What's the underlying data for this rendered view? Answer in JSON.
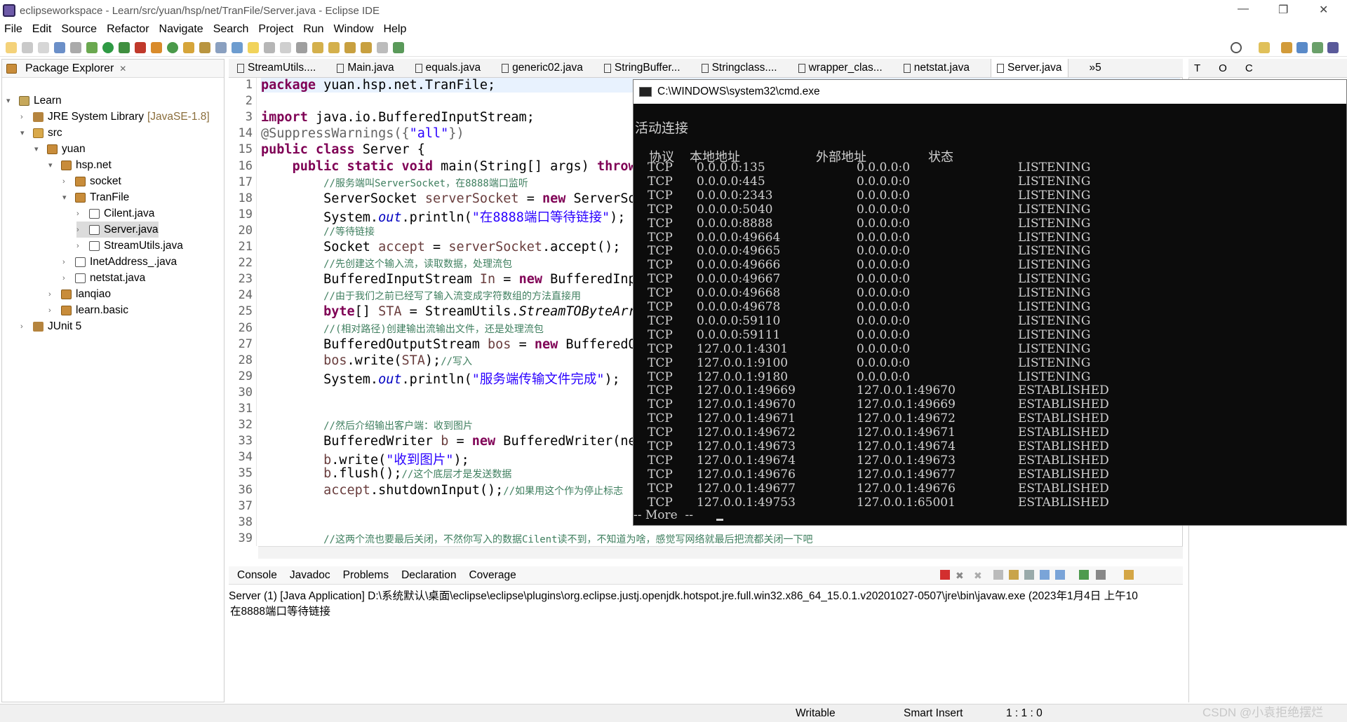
{
  "window": {
    "title": "eclipseworkspace - Learn/src/yuan/hsp/net/TranFile/Server.java - Eclipse IDE"
  },
  "menu": [
    "File",
    "Edit",
    "Source",
    "Refactor",
    "Navigate",
    "Search",
    "Project",
    "Run",
    "Window",
    "Help"
  ],
  "package_explorer": {
    "title": "Package Explorer",
    "tree": [
      {
        "label": "Learn",
        "icon": "project-icon",
        "twisty": "▾"
      },
      {
        "label": "JRE System Library",
        "extra": "[JavaSE-1.8]",
        "icon": "library-icon",
        "twisty": "›"
      },
      {
        "label": "src",
        "icon": "source-folder-icon",
        "twisty": "▾"
      },
      {
        "label": "yuan",
        "icon": "package-icon",
        "twisty": "▾"
      },
      {
        "label": "hsp.net",
        "icon": "package-icon",
        "twisty": "▾"
      },
      {
        "label": "socket",
        "icon": "package-icon",
        "twisty": "›"
      },
      {
        "label": "TranFile",
        "icon": "package-icon",
        "twisty": "▾"
      },
      {
        "label": "Cilent.java",
        "icon": "java-file-icon",
        "twisty": "›"
      },
      {
        "label": "Server.java",
        "icon": "java-file-icon",
        "twisty": "›"
      },
      {
        "label": "StreamUtils.java",
        "icon": "java-file-icon",
        "twisty": "›"
      },
      {
        "label": "InetAddress_.java",
        "icon": "java-file-icon",
        "twisty": "›"
      },
      {
        "label": "netstat.java",
        "icon": "java-file-icon",
        "twisty": "›"
      },
      {
        "label": "lanqiao",
        "icon": "package-icon",
        "twisty": "›"
      },
      {
        "label": "learn.basic",
        "icon": "package-icon",
        "twisty": "›"
      },
      {
        "label": "JUnit 5",
        "icon": "library-icon",
        "twisty": "›"
      }
    ]
  },
  "editor_tabs": [
    "StreamUtils....",
    "Main.java",
    "equals.java",
    "generic02.java",
    "StringBuffer...",
    "Stringclass....",
    "wrapper_clas...",
    "netstat.java",
    "Server.java"
  ],
  "editor_overflow": "»5",
  "code": {
    "line_numbers": [
      "1",
      "2",
      "3",
      "14",
      "15",
      "16",
      "17",
      "18",
      "19",
      "20",
      "21",
      "22",
      "23",
      "24",
      "25",
      "26",
      "27",
      "28",
      "29",
      "30",
      "31",
      "32",
      "33",
      "34",
      "35",
      "36",
      "37",
      "38",
      "39"
    ],
    "l1_kw": "package",
    "l1_rest": " yuan.hsp.net.TranFile;",
    "l3_kw": "import",
    "l3_rest": " java.io.BufferedInputStream;",
    "l14_ann": "@SuppressWarnings({",
    "l14_str": "\"all\"",
    "l14_end": "})",
    "l15_kw": "public class",
    "l15_rest": " Server {",
    "l16_kw": "public static void",
    "l16_rest": " main(String[] args) ",
    "l16_kw2": "throw",
    "l17_cmt": "//服务端叫ServerSocket，在8888端口监听",
    "l18_a": "ServerSocket ",
    "l18_var": "serverSocket",
    "l18_b": " = ",
    "l18_kw": "new",
    "l18_c": " ServerSo",
    "l19_a": "System.",
    "l19_fld": "out",
    "l19_b": ".println(",
    "l19_str": "\"在8888端口等待链接\"",
    "l19_c": ");",
    "l20_cmt": "//等待链接",
    "l21_a": "Socket ",
    "l21_var": "accept",
    "l21_b": " = ",
    "l21_var2": "serverSocket",
    "l21_c": ".accept();",
    "l22_cmt": "//先创建这个输入流，读取数据，处理流包",
    "l23_a": "BufferedInputStream ",
    "l23_var": "In",
    "l23_b": " = ",
    "l23_kw": "new",
    "l23_c": " BufferedInp",
    "l24_cmt": "//由于我们之前已经写了输入流变成字符数组的方法直接用",
    "l25_kw": "byte",
    "l25_a": "[] ",
    "l25_var": "STA",
    "l25_b": " = StreamUtils.",
    "l25_it": "StreamTOByteArr",
    "l26_cmt": "//(相对路径)创建输出流输出文件，还是处理流包",
    "l27_a": "BufferedOutputStream ",
    "l27_var": "bos",
    "l27_b": " = ",
    "l27_kw": "new",
    "l27_c": " BufferedO",
    "l28_var": "bos",
    "l28_a": ".write(",
    "l28_var2": "STA",
    "l28_b": ");",
    "l28_cmt": "//写入",
    "l29_a": "System.",
    "l29_fld": "out",
    "l29_b": ".println(",
    "l29_str": "\"服务端传输文件完成\"",
    "l29_c": ");",
    "l32_cmt": "//然后介绍输出客户端：收到图片",
    "l33_a": "BufferedWriter ",
    "l33_var": "b",
    "l33_b": " = ",
    "l33_kw": "new",
    "l33_c": " BufferedWriter(ne",
    "l34_var": "b",
    "l34_a": ".write(",
    "l34_str": "\"收到图片\"",
    "l34_b": ");",
    "l35_var": "b",
    "l35_a": ".flush();",
    "l35_cmt": "//这个底层才是发送数据",
    "l36_var": "accept",
    "l36_a": ".shutdownInput();",
    "l36_cmt": "//如果用这个作为停止标志",
    "l39_cmt": "//这两个流也要最后关闭，不然你写入的数据Cilent读不到，不知道为啥，感觉写网络就最后把流都关闭一下吧"
  },
  "cmd": {
    "title": "C:\\WINDOWS\\system32\\cmd.exe",
    "heading": "活动连接",
    "headers": {
      "proto": "协议",
      "local": "本地地址",
      "foreign": "外部地址",
      "state": "状态"
    },
    "rows": [
      [
        "TCP",
        "0.0.0.0:135",
        "0.0.0.0:0",
        "LISTENING"
      ],
      [
        "TCP",
        "0.0.0.0:445",
        "0.0.0.0:0",
        "LISTENING"
      ],
      [
        "TCP",
        "0.0.0.0:2343",
        "0.0.0.0:0",
        "LISTENING"
      ],
      [
        "TCP",
        "0.0.0.0:5040",
        "0.0.0.0:0",
        "LISTENING"
      ],
      [
        "TCP",
        "0.0.0.0:8888",
        "0.0.0.0:0",
        "LISTENING"
      ],
      [
        "TCP",
        "0.0.0.0:49664",
        "0.0.0.0:0",
        "LISTENING"
      ],
      [
        "TCP",
        "0.0.0.0:49665",
        "0.0.0.0:0",
        "LISTENING"
      ],
      [
        "TCP",
        "0.0.0.0:49666",
        "0.0.0.0:0",
        "LISTENING"
      ],
      [
        "TCP",
        "0.0.0.0:49667",
        "0.0.0.0:0",
        "LISTENING"
      ],
      [
        "TCP",
        "0.0.0.0:49668",
        "0.0.0.0:0",
        "LISTENING"
      ],
      [
        "TCP",
        "0.0.0.0:49678",
        "0.0.0.0:0",
        "LISTENING"
      ],
      [
        "TCP",
        "0.0.0.0:59110",
        "0.0.0.0:0",
        "LISTENING"
      ],
      [
        "TCP",
        "0.0.0.0:59111",
        "0.0.0.0:0",
        "LISTENING"
      ],
      [
        "TCP",
        "127.0.0.1:4301",
        "0.0.0.0:0",
        "LISTENING"
      ],
      [
        "TCP",
        "127.0.0.1:9100",
        "0.0.0.0:0",
        "LISTENING"
      ],
      [
        "TCP",
        "127.0.0.1:9180",
        "0.0.0.0:0",
        "LISTENING"
      ],
      [
        "TCP",
        "127.0.0.1:49669",
        "127.0.0.1:49670",
        "ESTABLISHED"
      ],
      [
        "TCP",
        "127.0.0.1:49670",
        "127.0.0.1:49669",
        "ESTABLISHED"
      ],
      [
        "TCP",
        "127.0.0.1:49671",
        "127.0.0.1:49672",
        "ESTABLISHED"
      ],
      [
        "TCP",
        "127.0.0.1:49672",
        "127.0.0.1:49671",
        "ESTABLISHED"
      ],
      [
        "TCP",
        "127.0.0.1:49673",
        "127.0.0.1:49674",
        "ESTABLISHED"
      ],
      [
        "TCP",
        "127.0.0.1:49674",
        "127.0.0.1:49673",
        "ESTABLISHED"
      ],
      [
        "TCP",
        "127.0.0.1:49676",
        "127.0.0.1:49677",
        "ESTABLISHED"
      ],
      [
        "TCP",
        "127.0.0.1:49677",
        "127.0.0.1:49676",
        "ESTABLISHED"
      ],
      [
        "TCP",
        "127.0.0.1:49753",
        "127.0.0.1:65001",
        "ESTABLISHED"
      ]
    ],
    "more": "-- More  --"
  },
  "outline": {
    "tab1": "T",
    "tab2": "O",
    "tab3": "C"
  },
  "console": {
    "tabs": [
      "Console",
      "Javadoc",
      "Problems",
      "Declaration",
      "Coverage"
    ],
    "launch": "Server (1) [Java Application] D:\\系统默认\\桌面\\eclipse\\eclipse\\plugins\\org.eclipse.justj.openjdk.hotspot.jre.full.win32.x86_64_15.0.1.v20201027-0507\\jre\\bin\\javaw.exe  (2023年1月4日 上午10",
    "output": "在8888端口等待链接"
  },
  "status": {
    "writable": "Writable",
    "insert": "Smart Insert",
    "position": "1 : 1 : 0"
  },
  "watermark": "CSDN @小袁拒绝摆烂"
}
